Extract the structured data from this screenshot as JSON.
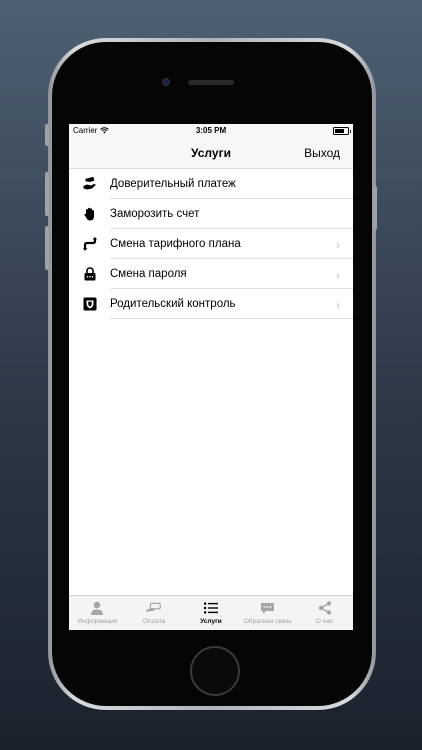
{
  "status_bar": {
    "carrier": "Carrier",
    "time": "3:05 PM"
  },
  "nav": {
    "title": "Услуги",
    "action": "Выход"
  },
  "services": [
    {
      "label": "Доверительный платеж",
      "icon": "hand-money-icon",
      "chevron": false
    },
    {
      "label": "Заморозить счет",
      "icon": "hand-stop-icon",
      "chevron": false
    },
    {
      "label": "Смена тарифного плана",
      "icon": "swap-arrows-icon",
      "chevron": true
    },
    {
      "label": "Смена пароля",
      "icon": "lock-icon",
      "chevron": true
    },
    {
      "label": "Родительский контроль",
      "icon": "shield-icon",
      "chevron": true
    }
  ],
  "tabs": [
    {
      "label": "Информация",
      "icon": "person-icon",
      "active": false
    },
    {
      "label": "Оплата",
      "icon": "card-hand-icon",
      "active": false
    },
    {
      "label": "Услуги",
      "icon": "list-icon",
      "active": true
    },
    {
      "label": "Обратная связь",
      "icon": "chat-icon",
      "active": false
    },
    {
      "label": "О нас",
      "icon": "share-icon",
      "active": false
    }
  ],
  "chevron_glyph": "›"
}
